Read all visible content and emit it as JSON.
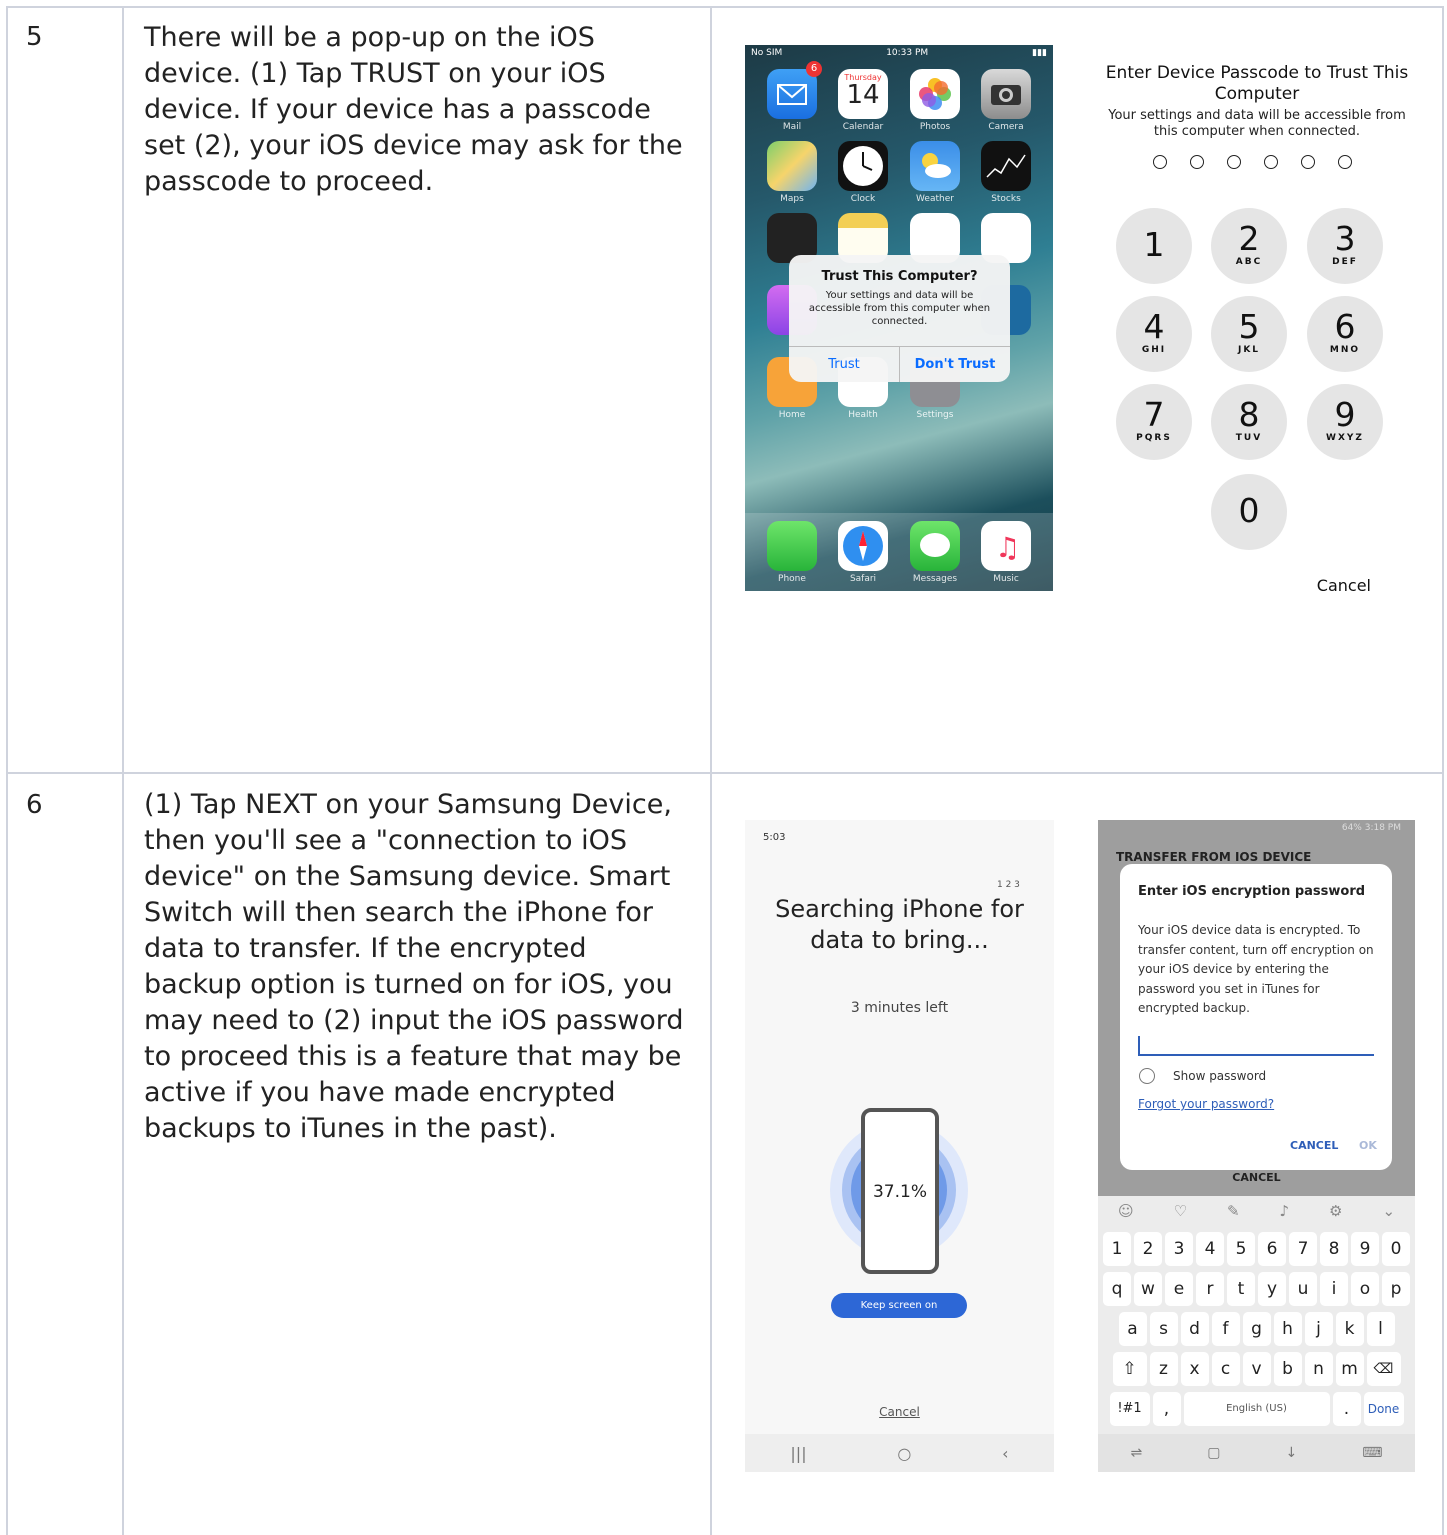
{
  "steps": [
    {
      "number": "5",
      "description": "There will be a pop-up on the iOS device. (1) Tap TRUST on your iOS device. If your device has a passcode set (2), your iOS device may ask for the passcode to proceed."
    },
    {
      "number": "6",
      "description": "(1) Tap NEXT on your Samsung Device, then you'll see a \"connection to iOS device\" on the Samsung device. Smart Switch will then search the iPhone for data to transfer. If the encrypted backup option is turned on for iOS, you may need to (2) input the iOS password to proceed this is a feature that may be active if you have made encrypted backups to iTunes in the past)."
    }
  ],
  "iphone_home": {
    "status_left": "No SIM",
    "status_time": "10:33 PM",
    "mail_badge": "6",
    "calendar_day": "Thursday",
    "calendar_date": "14",
    "apps": [
      "Mail",
      "Calendar",
      "Photos",
      "Camera",
      "Maps",
      "Clock",
      "Weather",
      "Stocks",
      "Home",
      "Health",
      "Settings"
    ],
    "dock": [
      "Phone",
      "Safari",
      "Messages",
      "Music"
    ],
    "alert_title": "Trust This Computer?",
    "alert_message": "Your settings and data will be accessible from this computer when connected.",
    "trust_label": "Trust",
    "dont_trust_label": "Don't Trust"
  },
  "passcode": {
    "title": "Enter Device Passcode to Trust This Computer",
    "subtitle": "Your settings and data will be accessible from this computer when connected.",
    "keys": [
      {
        "n": "1",
        "l": ""
      },
      {
        "n": "2",
        "l": "ABC"
      },
      {
        "n": "3",
        "l": "DEF"
      },
      {
        "n": "4",
        "l": "GHI"
      },
      {
        "n": "5",
        "l": "JKL"
      },
      {
        "n": "6",
        "l": "MNO"
      },
      {
        "n": "7",
        "l": "PQRS"
      },
      {
        "n": "8",
        "l": "TUV"
      },
      {
        "n": "9",
        "l": "WXYZ"
      },
      {
        "n": "0",
        "l": ""
      }
    ],
    "cancel": "Cancel"
  },
  "searching": {
    "status_time": "5:03",
    "step_indicator": "1 2 3",
    "title": "Searching iPhone for data to bring...",
    "time_left": "3 minutes left",
    "progress": "37.1%",
    "keep_screen": "Keep screen on",
    "cancel": "Cancel",
    "nav": [
      "|||",
      "○",
      "‹"
    ]
  },
  "encryption": {
    "status_right": "64% 3:18 PM",
    "header": "TRANSFER FROM IOS DEVICE",
    "dialog_title": "Enter iOS encryption password",
    "dialog_body": "Your iOS device data is encrypted. To transfer content, turn off encryption on your iOS device by entering the password you set in iTunes for encrypted backup.",
    "show_password": "Show password",
    "forgot": "Forgot your password?",
    "cancel_btn": "CANCEL",
    "ok_btn": "OK",
    "cancel_under": "CANCEL",
    "row_numbers": [
      "1",
      "2",
      "3",
      "4",
      "5",
      "6",
      "7",
      "8",
      "9",
      "0"
    ],
    "row_q": [
      "q",
      "w",
      "e",
      "r",
      "t",
      "y",
      "u",
      "i",
      "o",
      "p"
    ],
    "row_a": [
      "a",
      "s",
      "d",
      "f",
      "g",
      "h",
      "j",
      "k",
      "l"
    ],
    "row_z": [
      "⇧",
      "z",
      "x",
      "c",
      "v",
      "b",
      "n",
      "m",
      "⌫"
    ],
    "sym_key": "!#1",
    "comma_key": ",",
    "space_key": "English (US)",
    "period_key": ".",
    "done_key": "Done"
  }
}
